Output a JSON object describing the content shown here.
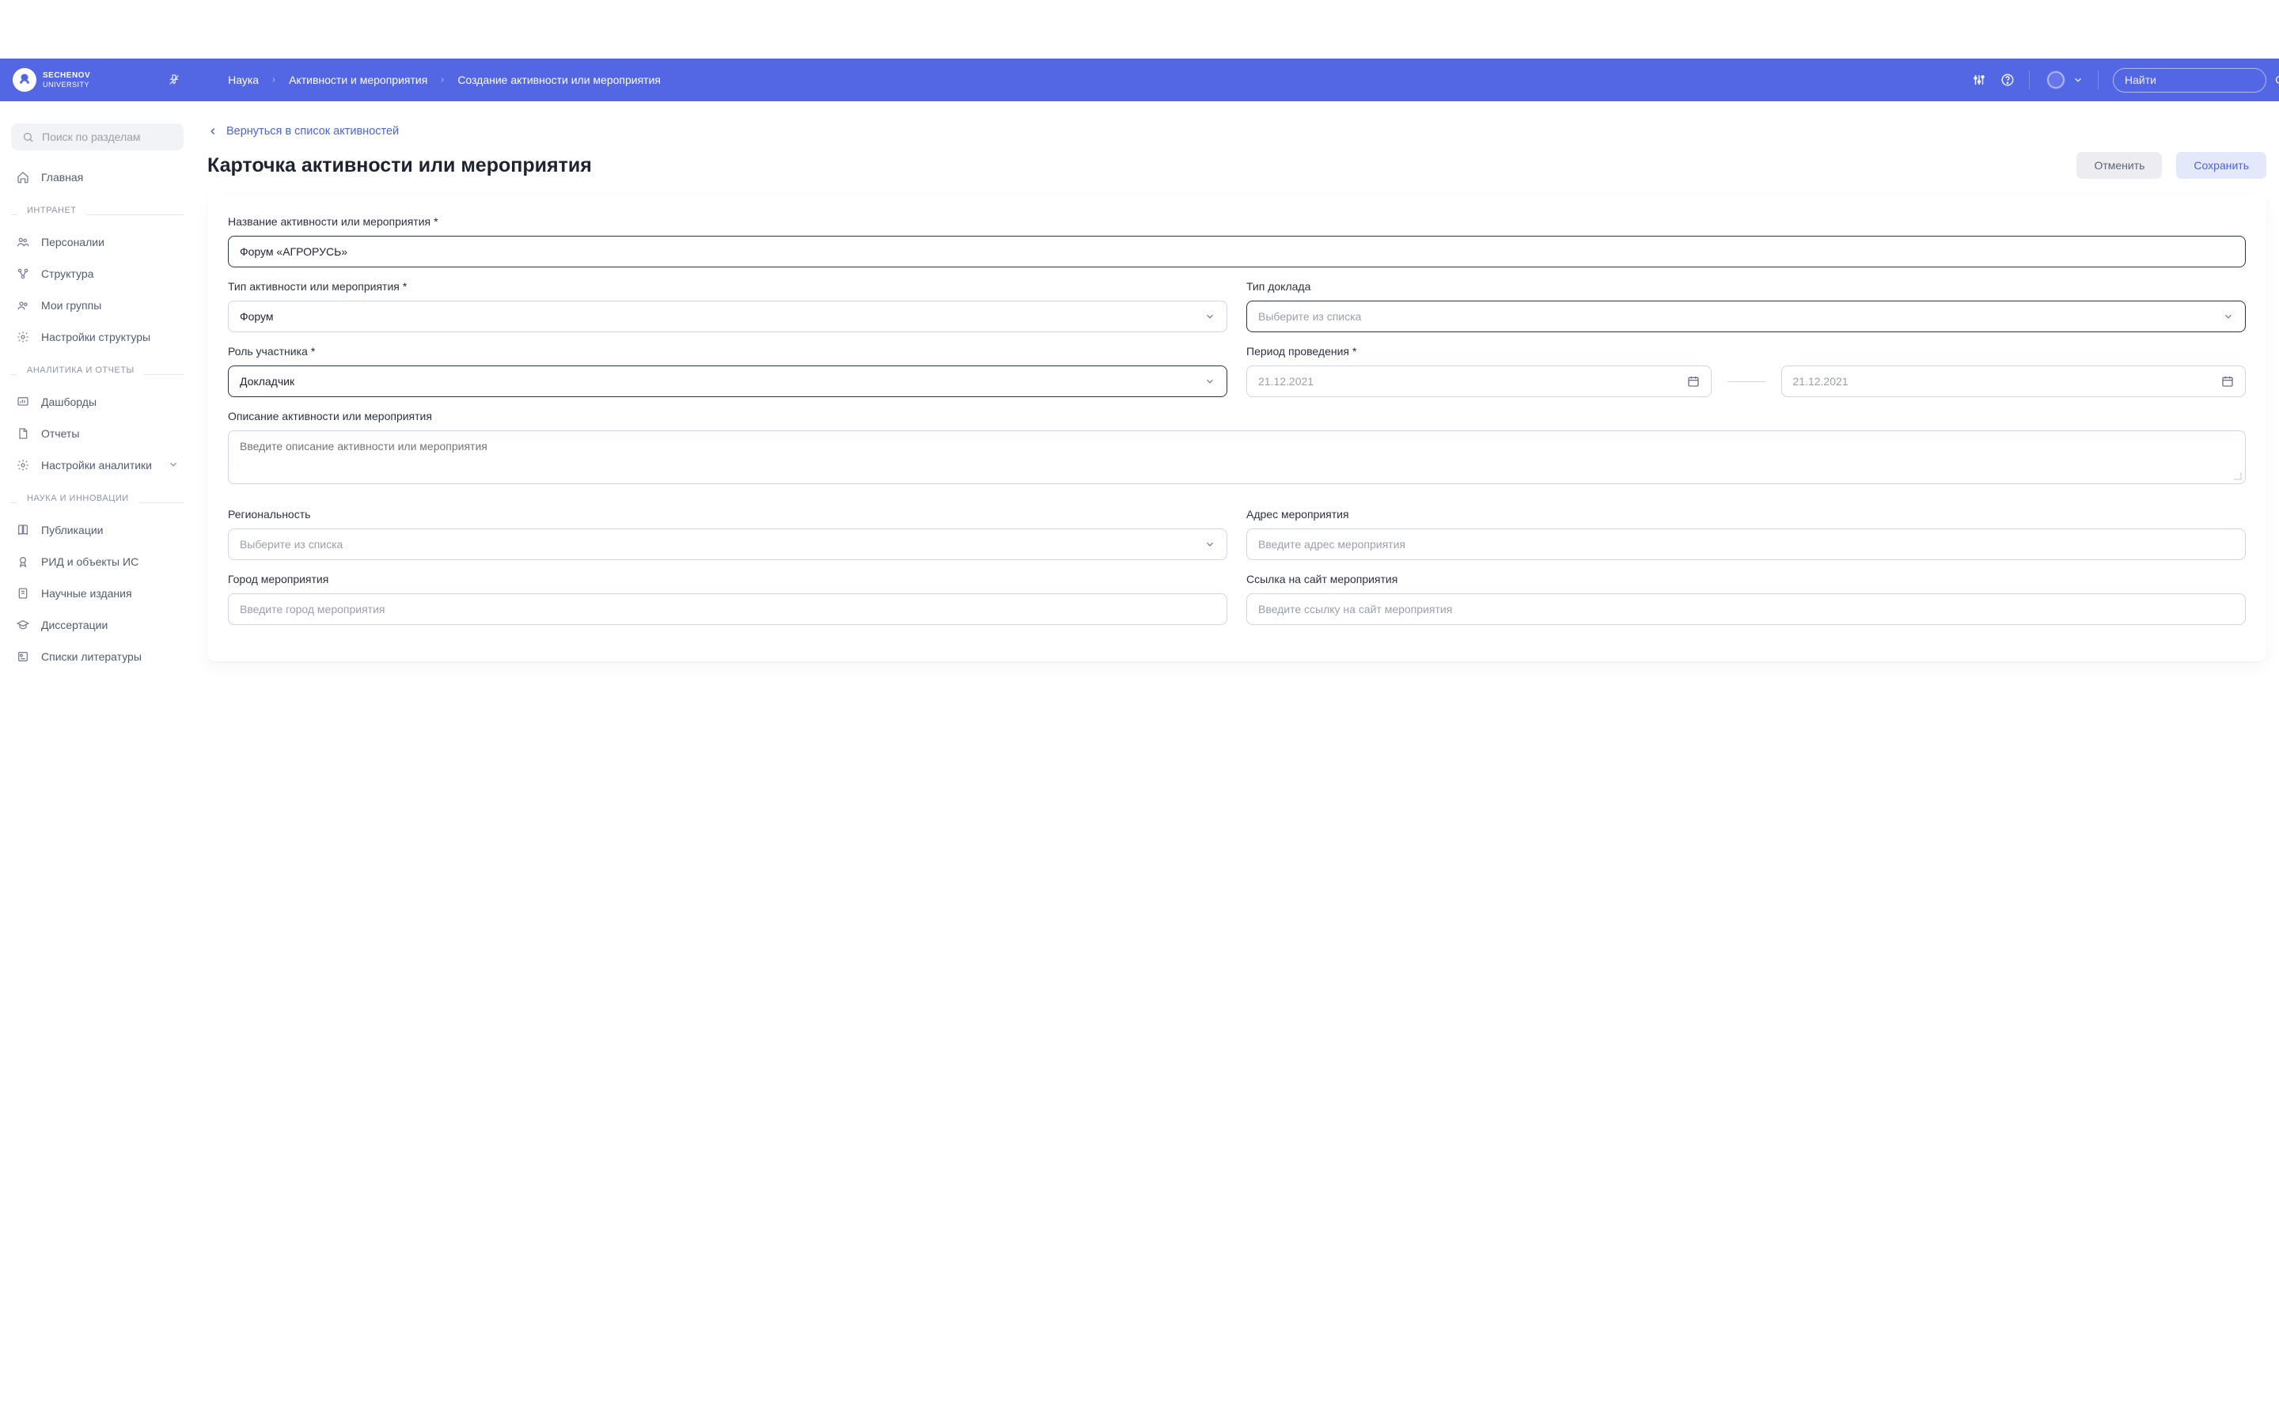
{
  "logo": {
    "main": "SECHENOV",
    "sub": "UNIVERSITY"
  },
  "breadcrumb": [
    "Наука",
    "Активности и мероприятия",
    "Создание активности или мероприятия"
  ],
  "search_top_placeholder": "Найти",
  "sidebar": {
    "search_placeholder": "Поиск по разделам",
    "home": "Главная",
    "sections": [
      {
        "label": "ИНТРАНЕТ",
        "items": [
          "Персоналии",
          "Структура",
          "Мои группы",
          "Настройки структуры"
        ]
      },
      {
        "label": "АНАЛИТИКА И ОТЧЕТЫ",
        "items": [
          "Дашборды",
          "Отчеты",
          "Настройки аналитики"
        ]
      },
      {
        "label": "НАУКА И ИННОВАЦИИ",
        "items": [
          "Публикации",
          "РИД и объекты ИС",
          "Научные издания",
          "Диссертации",
          "Списки литературы"
        ]
      }
    ]
  },
  "back_link": "Вернуться в список активностей",
  "page_title": "Карточка активности или мероприятия",
  "buttons": {
    "cancel": "Отменить",
    "save": "Сохранить"
  },
  "form": {
    "name": {
      "label": "Название активности или мероприятия",
      "value": "Форум «АГРОРУСЬ»"
    },
    "type": {
      "label": "Тип активности или мероприятия",
      "value": "Форум"
    },
    "report_type": {
      "label": "Тип доклада",
      "placeholder": "Выберите из списка"
    },
    "role": {
      "label": "Роль участника",
      "value": "Докладчик"
    },
    "period": {
      "label": "Период проведения",
      "from": "21.12.2021",
      "to": "21.12.2021"
    },
    "description": {
      "label": "Описание активности или мероприятия",
      "placeholder": "Введите описание активности или мероприятия"
    },
    "regionality": {
      "label": "Региональность",
      "placeholder": "Выберите из списка"
    },
    "address": {
      "label": "Адрес мероприятия",
      "placeholder": "Введите адрес мероприятия"
    },
    "city": {
      "label": "Город мероприятия",
      "placeholder": "Введите город мероприятия"
    },
    "link": {
      "label": "Ссылка на сайт мероприятия",
      "placeholder": "Введите ссылку на сайт мероприятия"
    }
  }
}
